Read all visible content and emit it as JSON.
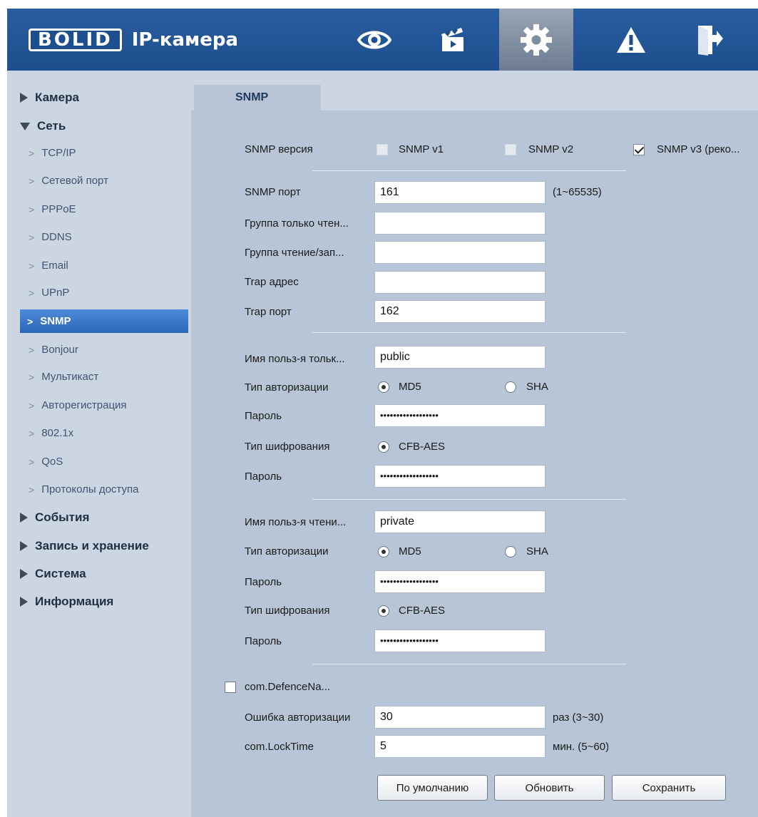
{
  "header": {
    "logo_text": "BOLID",
    "app_title": "IP-камера",
    "nav": [
      {
        "icon": "eye-icon"
      },
      {
        "icon": "clapperboard-icon"
      },
      {
        "icon": "gear-icon",
        "active": true
      },
      {
        "icon": "warning-icon"
      },
      {
        "icon": "logout-icon"
      }
    ]
  },
  "sidebar": {
    "groups": {
      "camera": "Камера",
      "network": "Сеть",
      "events": "События",
      "storage": "Запись и хранение",
      "system": "Система",
      "info": "Информация"
    },
    "items": [
      "TCP/IP",
      "Сетевой порт",
      "PPPoE",
      "DDNS",
      "Email",
      "UPnP",
      "SNMP",
      "Bonjour",
      "Мультикаст",
      "Авторегистрация",
      "802.1x",
      "QoS",
      "Протоколы доступа"
    ],
    "active_item": "SNMP"
  },
  "tab": {
    "label": "SNMP"
  },
  "form": {
    "version_label": "SNMP версия",
    "v1_label": "SNMP v1",
    "v2_label": "SNMP v2",
    "v3_label": "SNMP v3 (реко...",
    "v1_checked": false,
    "v2_checked": false,
    "v3_checked": true,
    "port_label": "SNMP порт",
    "port_value": "161",
    "port_hint": "(1~65535)",
    "read_group_label": "Группа только чтен...",
    "read_group_value": "",
    "rw_group_label": "Группа чтение/зап...",
    "rw_group_value": "",
    "trap_addr_label": "Trap адрес",
    "trap_addr_value": "",
    "trap_port_label": "Trap порт",
    "trap_port_value": "162",
    "ro_user": {
      "name_label": "Имя польз-я тольк...",
      "name_value": "public",
      "auth_label": "Тип авторизации",
      "auth_md5": "MD5",
      "auth_sha": "SHA",
      "auth_selected": "MD5",
      "pass_label": "Пароль",
      "pass_value": "••••••••••••••••••",
      "enc_label": "Тип шифрования",
      "enc_option": "CFB-AES",
      "enc_pass_label": "Пароль",
      "enc_pass_value": "••••••••••••••••••"
    },
    "rw_user": {
      "name_label": "Имя польз-я чтени...",
      "name_value": "private",
      "auth_label": "Тип авторизации",
      "auth_md5": "MD5",
      "auth_sha": "SHA",
      "auth_selected": "MD5",
      "pass_label": "Пароль",
      "pass_value": "••••••••••••••••••",
      "enc_label": "Тип шифрования",
      "enc_option": "CFB-AES",
      "enc_pass_label": "Пароль",
      "enc_pass_value": "••••••••••••••••••"
    },
    "defence_label": "com.DefenceNa...",
    "defence_checked": false,
    "auth_error_label": "Ошибка авторизации",
    "auth_error_value": "30",
    "auth_error_hint": "раз (3~30)",
    "lock_label": "com.LockTime",
    "lock_value": "5",
    "lock_hint": "мин. (5~60)"
  },
  "buttons": {
    "default": "По умолчанию",
    "refresh": "Обновить",
    "save": "Сохранить"
  }
}
